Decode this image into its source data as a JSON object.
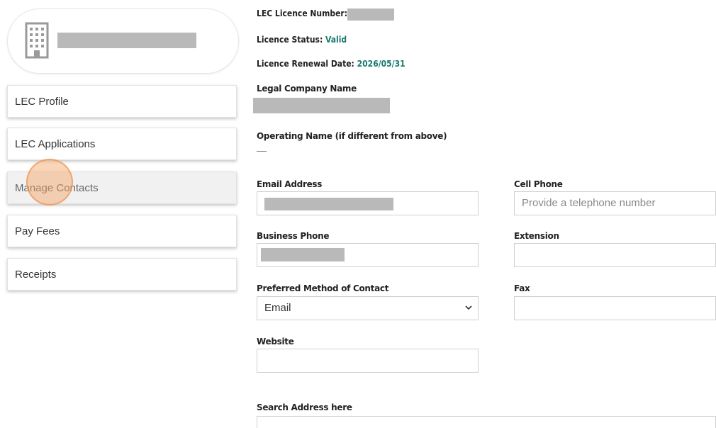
{
  "sidebar": {
    "company_icon": "building-icon",
    "nav": [
      {
        "label": "LEC Profile"
      },
      {
        "label": "LEC Applications"
      },
      {
        "label": "Manage Contacts"
      },
      {
        "label": "Pay Fees"
      },
      {
        "label": "Receipts"
      }
    ]
  },
  "licence": {
    "number_label": "LEC Licence Number:",
    "status_label": "Licence Status:",
    "status_value": "Valid",
    "renewal_label": "Licence Renewal Date:",
    "renewal_value": "2026/05/31"
  },
  "form": {
    "legal_name_label": "Legal Company Name",
    "operating_name_label": "Operating Name (if different from above)",
    "operating_name_value": "—",
    "email_label": "Email Address",
    "cell_label": "Cell Phone",
    "cell_placeholder": "Provide a telephone number",
    "business_phone_label": "Business Phone",
    "extension_label": "Extension",
    "preferred_label": "Preferred Method of Contact",
    "preferred_value": "Email",
    "fax_label": "Fax",
    "website_label": "Website",
    "search_address_label": "Search Address here"
  },
  "colors": {
    "accent": "#1a7a6e",
    "redaction": "#b9b9b9",
    "click_marker": "#f4a261"
  }
}
